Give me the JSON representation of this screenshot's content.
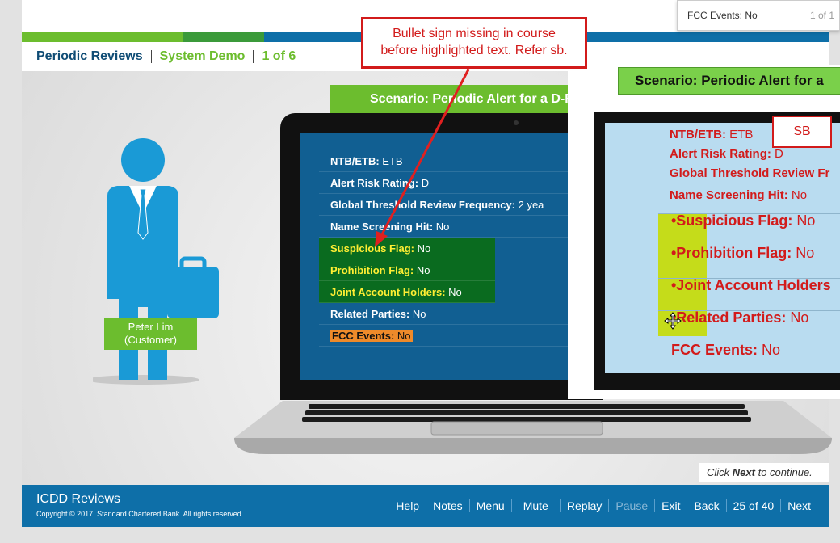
{
  "header": {
    "crumb_course": "Periodic Reviews",
    "crumb_module": "System Demo",
    "crumb_progress": "1 of 6"
  },
  "tooltip": {
    "label": "FCC Events: No",
    "page": "1 of 1"
  },
  "callout": {
    "line1": "Bullet sign missing in course",
    "line2": "before highlighted text. Refer sb."
  },
  "scenario": {
    "title": "Scenario: Periodic Alert for a D-R"
  },
  "customer": {
    "name": "Peter Lim",
    "role": "(Customer)"
  },
  "screen_rows": [
    {
      "label": "NTB/ETB:",
      "value": " ETB"
    },
    {
      "label": "Alert Risk Rating:",
      "value": " D"
    },
    {
      "label": "Global Threshold Review Frequency:",
      "value": " 2 yea"
    },
    {
      "label": "Name Screening Hit:",
      "value": " No"
    },
    {
      "label": "Suspicious Flag:",
      "value": " No"
    },
    {
      "label": "Prohibition Flag:",
      "value": " No"
    },
    {
      "label": "Joint Account Holders:",
      "value": " No"
    },
    {
      "label": "Related Parties:",
      "value": " No"
    },
    {
      "label": "FCC Events:",
      "value": " No"
    }
  ],
  "reference": {
    "title": "Scenario: Periodic Alert for a",
    "sb_label": "SB",
    "rows": [
      {
        "label": "NTB/ETB:",
        "value": " ETB"
      },
      {
        "label": "Alert Risk Rating:",
        "value": " D"
      },
      {
        "label": "Global Threshold Review Fr",
        "value": ""
      },
      {
        "label": "Name Screening Hit:",
        "value": " No"
      },
      {
        "label": "•Suspicious Flag:",
        "value": " No"
      },
      {
        "label": "•Prohibition Flag:",
        "value": " No"
      },
      {
        "label": "•Joint Account Holders",
        "value": ""
      },
      {
        "label": "•Related Parties:",
        "value": " No"
      },
      {
        "label": "FCC Events:",
        "value": " No"
      }
    ]
  },
  "continue": {
    "prefix": "Click ",
    "next": "Next",
    "suffix": " to continue."
  },
  "footer": {
    "brand": "ICDD Reviews",
    "copyright": "Copyright © 2017. Standard Chartered Bank. All rights reserved.",
    "help": "Help",
    "notes": "Notes",
    "menu": "Menu",
    "mute": "Mute",
    "replay": "Replay",
    "pause": "Pause",
    "exit": "Exit",
    "back": "Back",
    "page": "25 of 40",
    "next": "Next"
  },
  "colors": {
    "brand_blue": "#0e6fa8",
    "brand_green": "#6cbd2e",
    "callout_red": "#d21b1b",
    "highlight_green": "#0a6b1f",
    "highlight_yellow": "#ffee33"
  }
}
